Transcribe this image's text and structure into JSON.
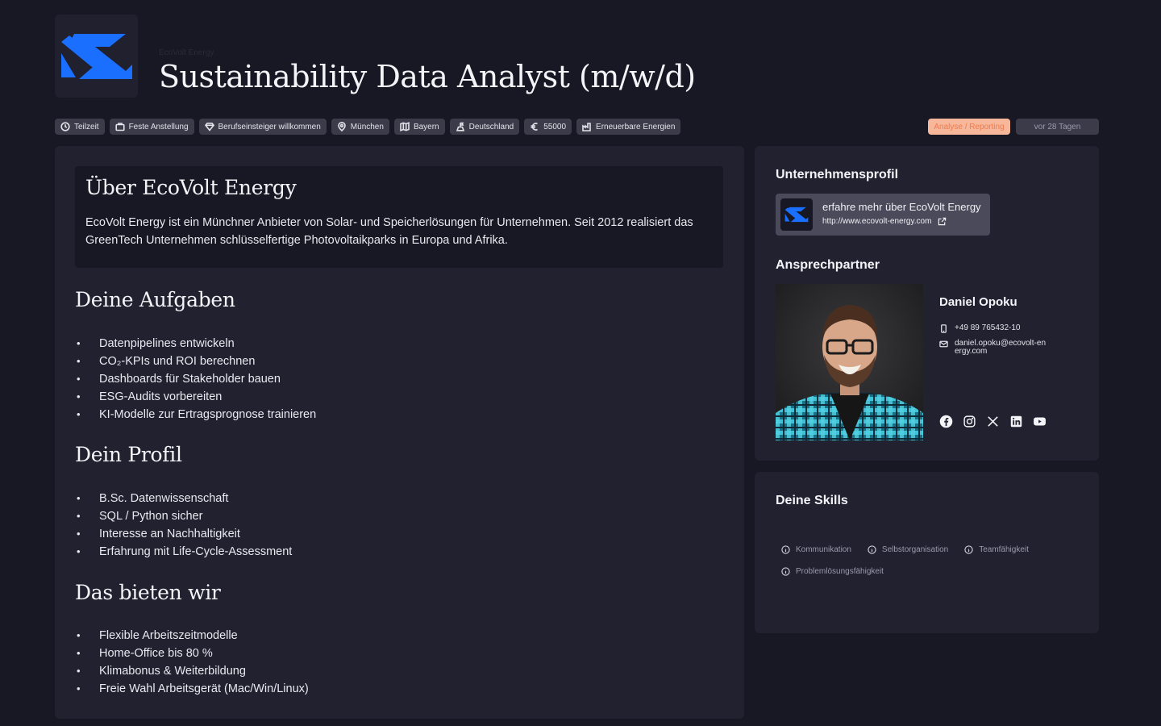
{
  "header": {
    "company_small": "EcoVolt Energy",
    "title": "Sustainability Data Analyst (m/w/d)",
    "brand_color": "#1a6fff"
  },
  "tags": [
    {
      "icon": "clock-icon",
      "label": "Teilzeit"
    },
    {
      "icon": "briefcase-icon",
      "label": "Feste Anstellung"
    },
    {
      "icon": "diamond-icon",
      "label": "Berufseinsteiger willkommen"
    },
    {
      "icon": "map-pin-icon",
      "label": "München"
    },
    {
      "icon": "map-icon",
      "label": "Bayern"
    },
    {
      "icon": "flag-icon",
      "label": "Deutschland"
    },
    {
      "icon": "euro-icon",
      "label": "55000"
    },
    {
      "icon": "factory-icon",
      "label": "Erneuerbare Energien"
    }
  ],
  "category_badge": "Analyse / Reporting",
  "posted": "vor 28 Tagen",
  "about": {
    "title": "Über EcoVolt Energy",
    "text": "EcoVolt Energy ist ein Münchner Anbieter von Solar- und Speicherlösungen für Unternehmen. Seit 2012 realisiert das GreenTech Unternehmen schlüsselfertige Photovoltaikparks in Europa und Afrika."
  },
  "tasks": {
    "title": "Deine Aufgaben",
    "items": [
      "Datenpipelines entwickeln",
      "CO₂-KPIs und ROI berechnen",
      "Dashboards für Stakeholder bauen",
      "ESG-Audits vorbereiten",
      "KI-Modelle zur Ertragsprognose trainieren"
    ]
  },
  "profile": {
    "title": "Dein Profil",
    "items": [
      "B.Sc. Datenwissenschaft",
      "SQL / Python sicher",
      "Interesse an Nachhaltigkeit",
      "Erfahrung mit Life-Cycle-Assessment"
    ]
  },
  "offer": {
    "title": "Das bieten wir",
    "items": [
      "Flexible Arbeitszeitmodelle",
      "Home-Office bis 80 %",
      "Klimabonus & Weiterbildung",
      "Freie Wahl Arbeitsgerät (Mac/Win/Linux)"
    ]
  },
  "company_card": {
    "title": "Unternehmensprofil",
    "link_text": "erfahre mehr über EcoVolt Energy",
    "url": "http://www.ecovolt-energy.com"
  },
  "contact": {
    "title": "Ansprechpartner",
    "name": "Daniel Opoku",
    "phone": "+49 89 765432-10",
    "email": "daniel.opoku@ecovolt-energy.com",
    "socials": [
      "facebook-icon",
      "instagram-icon",
      "x-icon",
      "linkedin-icon",
      "youtube-icon"
    ]
  },
  "skills": {
    "title": "Deine Skills",
    "items": [
      "Kommunikation",
      "Selbstorganisation",
      "Teamfähigkeit",
      "Problemlösungsfähigkeit"
    ]
  }
}
